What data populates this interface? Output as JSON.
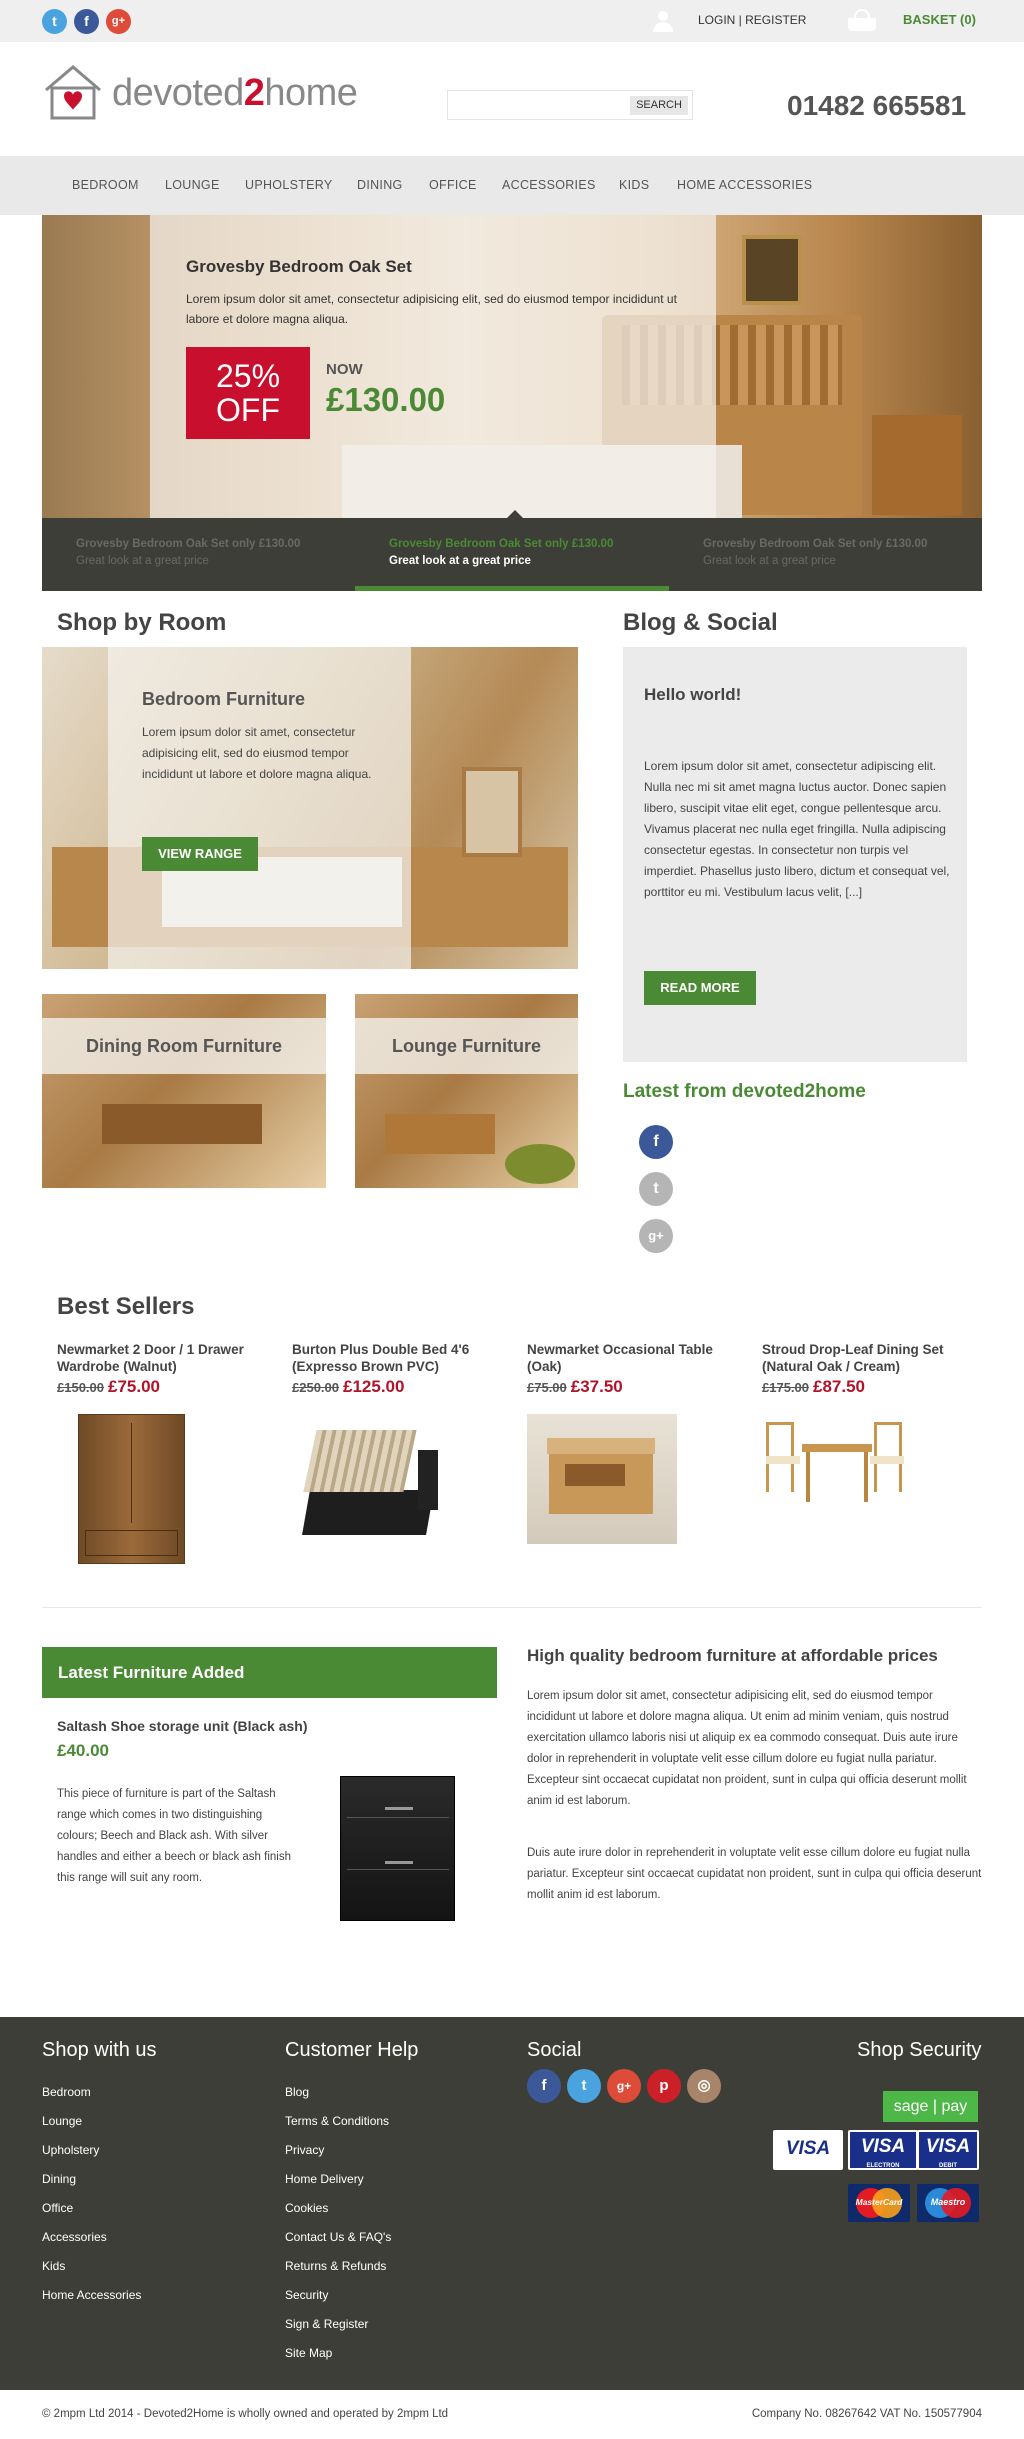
{
  "topbar": {
    "social": [
      {
        "icon": "twitter-icon",
        "glyph": "t",
        "color": "#4aa3df"
      },
      {
        "icon": "facebook-icon",
        "glyph": "f",
        "color": "#3b5998"
      },
      {
        "icon": "google-plus-icon",
        "glyph": "g+",
        "color": "#dd4b39"
      }
    ],
    "login_label": "LOGIN | REGISTER",
    "basket_label": "BASKET (0)"
  },
  "header": {
    "logo_part1": "devoted",
    "logo_part2": "2",
    "logo_part3": "home",
    "search_button": "SEARCH",
    "search_placeholder": "",
    "phone": "01482 665581"
  },
  "nav": {
    "items": [
      "BEDROOM",
      "LOUNGE",
      "UPHOLSTERY",
      "DINING",
      "OFFICE",
      "ACCESSORIES",
      "KIDS",
      "HOME ACCESSORIES"
    ]
  },
  "hero": {
    "title": "Grovesby Bedroom Oak Set",
    "text": "Lorem ipsum dolor sit amet, consectetur adipisicing elit, sed do eiusmod tempor incididunt ut labore et dolore magna aliqua.",
    "badge_line1": "25%",
    "badge_line2": "OFF",
    "now_label": "NOW",
    "price": "£130.00",
    "slides": [
      {
        "title": "Grovesby Bedroom Oak Set only £130.00",
        "subtitle": "Great look at a great price"
      },
      {
        "title": "Grovesby Bedroom Oak Set only £130.00",
        "subtitle": "Great look at a great price"
      },
      {
        "title": "Grovesby Bedroom Oak Set only £130.00",
        "subtitle": "Great look at a great price"
      }
    ]
  },
  "shop_by_room": {
    "title": "Shop by Room",
    "big": {
      "title": "Bedroom Furniture",
      "text": "Lorem ipsum dolor sit amet, consectetur adipisicing elit, sed do eiusmod tempor incididunt ut labore et dolore magna aliqua.",
      "button": "VIEW RANGE"
    },
    "dining": "Dining Room Furniture",
    "lounge": "Lounge Furniture"
  },
  "blog": {
    "title": "Blog & Social",
    "post_title": "Hello world!",
    "post_text": "Lorem ipsum dolor sit amet, consectetur adipiscing elit. Nulla nec mi sit amet magna luctus auctor. Donec sapien libero, suscipit vitae elit eget, congue pellentesque arcu. Vivamus placerat nec nulla eget fringilla. Nulla adipiscing consectetur egestas. In consectetur non turpis vel imperdiet. Phasellus justo libero, dictum et consequat vel, porttitor eu mi. Vestibulum lacus velit, [...]",
    "button": "READ MORE",
    "latest_title": "Latest from devoted2home"
  },
  "best_sellers": {
    "title": "Best Sellers",
    "products": [
      {
        "name": "Newmarket 2 Door / 1 Drawer Wardrobe (Walnut)",
        "old": "£150.00",
        "new": "£75.00"
      },
      {
        "name": "Burton Plus Double Bed 4'6 (Expresso Brown PVC)",
        "old": "£250.00",
        "new": "£125.00"
      },
      {
        "name": "Newmarket Occasional Table (Oak)",
        "old": "£75.00",
        "new": "£37.50"
      },
      {
        "name": "Stroud Drop-Leaf Dining Set (Natural Oak / Cream)",
        "old": "£175.00",
        "new": "£87.50"
      }
    ]
  },
  "latest_added": {
    "header": "Latest Furniture Added",
    "product_name": "Saltash Shoe storage unit (Black ash)",
    "price": "£40.00",
    "text": "This piece of furniture is part of the Saltash range which comes in two distinguishing colours; Beech and Black ash. With silver handles and either a beech or black ash finish this range will suit any room."
  },
  "about": {
    "title": "High quality bedroom furniture at affordable prices",
    "para1": "Lorem ipsum dolor sit amet, consectetur adipisicing elit, sed do eiusmod tempor incididunt ut labore et dolore magna aliqua. Ut enim ad minim veniam, quis nostrud exercitation ullamco laboris nisi ut aliquip ex ea commodo consequat. Duis aute irure dolor in reprehenderit in voluptate velit esse cillum dolore eu fugiat nulla pariatur. Excepteur sint occaecat cupidatat non proident, sunt in culpa qui officia deserunt mollit anim id est laborum.",
    "para2": "Duis aute irure dolor in reprehenderit in voluptate velit esse cillum dolore eu fugiat nulla pariatur. Excepteur sint occaecat cupidatat non proident, sunt in culpa qui officia deserunt mollit anim id est laborum."
  },
  "footer": {
    "shop_title": "Shop with us",
    "shop_links": [
      "Bedroom",
      "Lounge",
      "Upholstery",
      "Dining",
      "Office",
      "Accessories",
      "Kids",
      "Home Accessories"
    ],
    "help_title": "Customer Help",
    "help_links": [
      "Blog",
      "Terms & Conditions",
      "Privacy",
      "Home Delivery",
      "Cookies",
      "Contact Us & FAQ's",
      "Returns & Refunds",
      "Security",
      "Sign & Register",
      "Site Map"
    ],
    "social_title": "Social",
    "security_title": "Shop Security",
    "sagepay_a": "sage",
    "sagepay_b": "pay",
    "card1": "VISA",
    "card2": "VISA",
    "card2_sub": "ELECTRON",
    "card3": "VISA",
    "card3_sub": "DEBIT",
    "mastercard": "MasterCard",
    "maestro": "Maestro"
  },
  "bottom": {
    "left": "© 2mpm Ltd 2014 - Devoted2Home is wholly owned and operated by 2mpm Ltd",
    "right": "Company No. 08267642 VAT No. 150577904"
  },
  "colors": {
    "accent_green": "#4b8a35",
    "price_red": "#b0142a",
    "footer_bg": "#3e3e38"
  }
}
